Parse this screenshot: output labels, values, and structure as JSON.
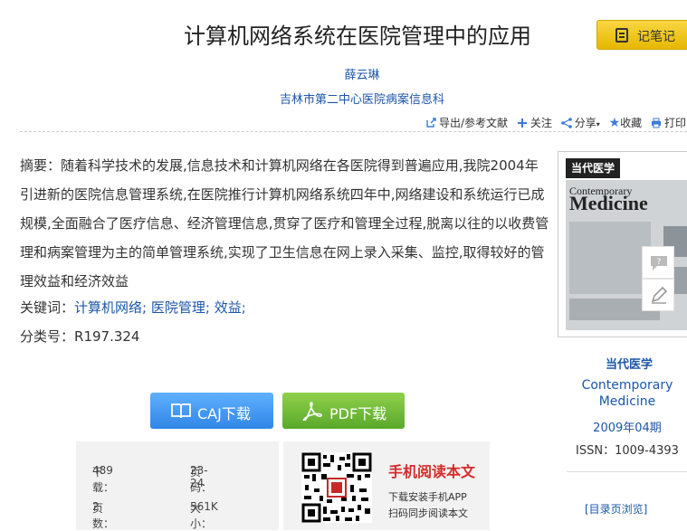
{
  "title": "计算机网络系统在医院管理中的应用",
  "note_button": {
    "label": "记笔记"
  },
  "author": "薛云琳",
  "organization": "吉林市第二中心医院病案信息科",
  "toolbar": {
    "export": "导出/参考文献",
    "follow": "关注",
    "share": "分享",
    "collect": "收藏",
    "print": "打印"
  },
  "abstract": {
    "label": "摘要：",
    "text": "随着科学技术的发展,信息技术和计算机网络在各医院得到普遍应用,我院2004年引进新的医院信息管理系统,在医院推行计算机网络系统四年中,网络建设和系统运行已成规模,全面融合了医疗信息、经济管理信息,贯穿了医疗和管理全过程,脱离以往的以收费管理和病案管理为主的简单管理系统,实现了卫生信息在网上录入采集、监控,取得较好的管理效益和经济效益"
  },
  "keywords": {
    "label": "关键词：",
    "items": [
      "计算机网络;",
      "医院管理;",
      "效益;"
    ]
  },
  "classification": {
    "label": "分类号：",
    "value": "R197.324"
  },
  "downloads": {
    "caj": "CAJ下载",
    "pdf": "PDF下载"
  },
  "stats": {
    "download_label": "下载：",
    "download_value": "489",
    "pages_range_label": "页码：",
    "pages_range_value": "23-24",
    "page_count_label": "页数：",
    "page_count_value": "2",
    "size_label": "大小：",
    "size_value": "561K"
  },
  "mobile": {
    "heading": "手机阅读本文",
    "desc1": "下载安装手机APP",
    "desc2": "扫码同步阅读本文"
  },
  "journal": {
    "name_cn": "当代医学",
    "name_en": "Contemporary Medicine",
    "issue": "2009年04期",
    "issn": "ISSN：1009-4393",
    "cover_title_cn": "当代医学",
    "cover_title_en_small": "Contemporary",
    "cover_title_en_big": "Medicine"
  },
  "toc_link": "[目录页浏览]"
}
